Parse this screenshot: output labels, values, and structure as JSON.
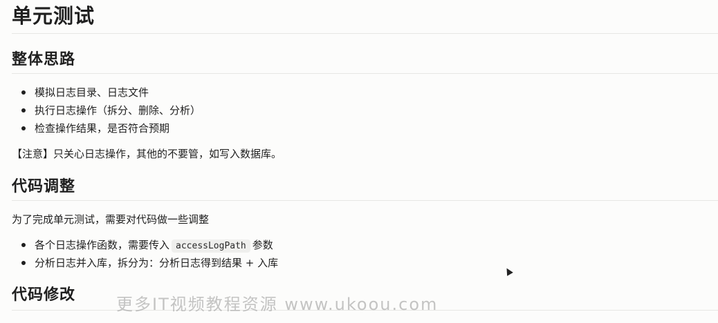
{
  "doc": {
    "title": "单元测试",
    "sections": [
      {
        "heading": "整体思路",
        "items": [
          "模拟日志目录、日志文件",
          "执行日志操作（拆分、删除、分析）",
          "检查操作结果，是否符合预期"
        ],
        "note": "【注意】只关心日志操作，其他的不要管，如写入数据库。"
      },
      {
        "heading": "代码调整",
        "intro": "为了完成单元测试，需要对代码做一些调整",
        "item1_prefix": "各个日志操作函数，需要传入",
        "item1_code": "accessLogPath",
        "item1_suffix": "参数",
        "item2": "分析日志并入库，拆分为：分析日志得到结果 + 入库"
      },
      {
        "heading": "代码修改"
      }
    ]
  },
  "watermark": "更多IT视频教程资源 www.ukoou.com",
  "colors": {
    "background": "#fcfcfb",
    "text": "#1f1f1f",
    "rule": "#e6e6e4",
    "code_bg": "#efefed"
  }
}
